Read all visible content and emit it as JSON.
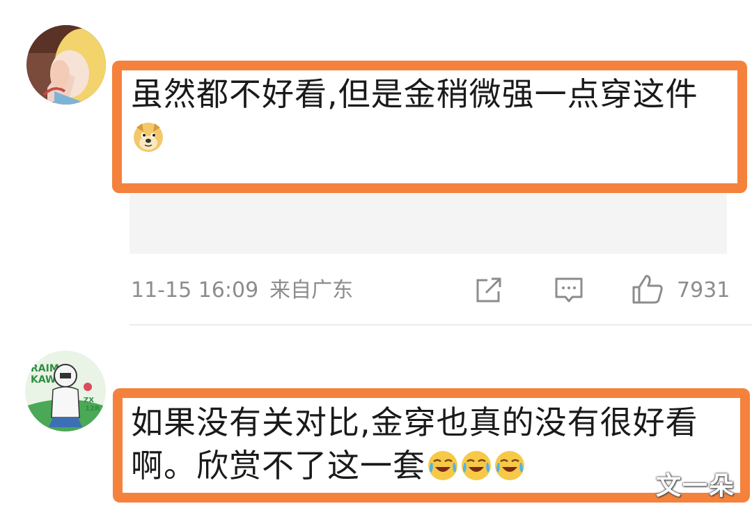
{
  "comments": [
    {
      "text": "虽然都不好看,但是金稍微强一点穿这件",
      "emojis": [
        "doge-emoji"
      ],
      "time": "11-15 16:09",
      "location": "来自广东",
      "likes": "7931"
    },
    {
      "text": "如果没有关对比,金穿也真的没有很好看啊。欣赏不了这一套",
      "emojis": [
        "laugh-cry-emoji",
        "laugh-cry-emoji",
        "laugh-cry-emoji"
      ]
    }
  ],
  "avatar2_text": [
    "RAIM",
    "KAWA",
    "ZX",
    "12R"
  ],
  "watermark": "文一朵",
  "colors": {
    "highlight": "#f5823c",
    "meta_text": "#8c8c8c",
    "body_text": "#1a1a1a"
  }
}
